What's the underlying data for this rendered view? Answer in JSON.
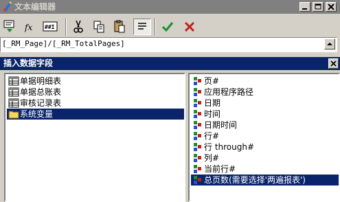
{
  "window": {
    "title": "文本编辑器"
  },
  "title_buttons": [
    "minimize-button",
    "maximize-button",
    "close-button"
  ],
  "formula": {
    "value": "[_RM_Page]/[_RM_TotalPages]"
  },
  "panel": {
    "title": "插入数据字段"
  },
  "left_list": {
    "items": [
      {
        "label": "单据明细表",
        "icon": "table-icon"
      },
      {
        "label": "单据总账表",
        "icon": "table-icon"
      },
      {
        "label": "审核记录表",
        "icon": "table-icon"
      },
      {
        "label": "系统变量",
        "icon": "folder-icon",
        "selected": true
      }
    ]
  },
  "right_list": {
    "items": [
      {
        "label": "页#"
      },
      {
        "label": "应用程序路径"
      },
      {
        "label": "日期"
      },
      {
        "label": "时间"
      },
      {
        "label": "日期时间"
      },
      {
        "label": "行#"
      },
      {
        "label": "行 through#"
      },
      {
        "label": "列#"
      },
      {
        "label": "当前行#"
      },
      {
        "label": "总页数(需要选择'两遍报表')",
        "selected": true
      }
    ]
  },
  "colors": {
    "titlebar_inactive": "#808080",
    "panel_header": "#0a246a",
    "selection": "#0a246a",
    "face": "#d4d0c8"
  }
}
